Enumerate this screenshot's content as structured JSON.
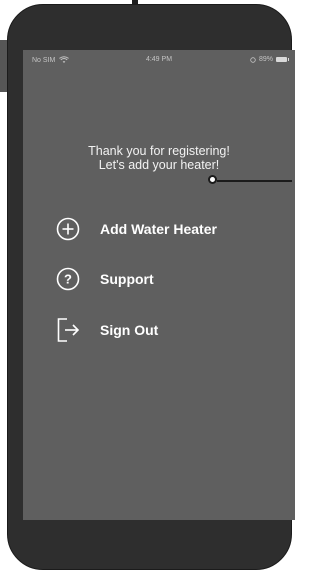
{
  "statusbar": {
    "carrier": "No SIM",
    "time": "4:49 PM",
    "battery": "89%"
  },
  "welcome": {
    "line1": "Thank you for registering!",
    "line2": "Let's add your heater!"
  },
  "menu": [
    {
      "label": "Add Water Heater",
      "icon": "plus-circle-icon"
    },
    {
      "label": "Support",
      "icon": "question-circle-icon"
    },
    {
      "label": "Sign Out",
      "icon": "sign-out-icon"
    }
  ],
  "colors": {
    "screen_bg": "#5f5f5f",
    "phone_body": "#2e2e2e",
    "text": "#ffffff"
  }
}
